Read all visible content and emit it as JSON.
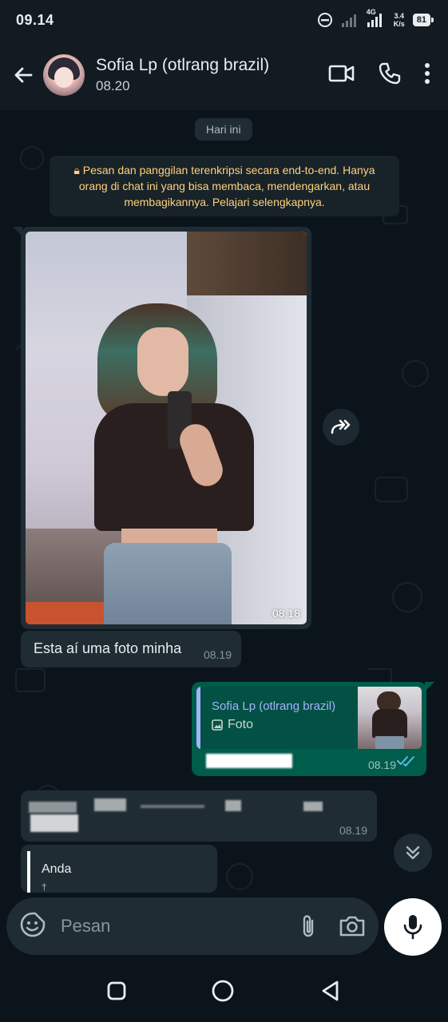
{
  "status_bar": {
    "time": "09.14",
    "network": "4G",
    "speed_value": "3.4",
    "speed_unit": "K/s",
    "battery": "81"
  },
  "header": {
    "contact_name": "Sofia Lp (otlrang brazil)",
    "last_seen": "08.20"
  },
  "chat": {
    "day_label": "Hari ini",
    "encryption_notice": "Pesan dan panggilan terenkripsi secara end-to-end. Hanya orang di chat ini yang bisa membaca, mendengarkan, atau membagikannya. Pelajari selengkapnya.",
    "messages": [
      {
        "type": "image",
        "direction": "in",
        "time": "08.18"
      },
      {
        "type": "text",
        "direction": "in",
        "text": "Esta aí uma foto minha",
        "time": "08.19"
      },
      {
        "type": "reply",
        "direction": "out",
        "quote_name": "Sofia Lp (otlrang brazil)",
        "quote_type": "Foto",
        "time": "08.19",
        "status": "read"
      },
      {
        "type": "text",
        "direction": "in",
        "time": "08.19"
      },
      {
        "type": "reply",
        "direction": "in",
        "quote_name": "Anda",
        "quote_more": "†"
      }
    ]
  },
  "composer": {
    "placeholder": "Pesan"
  },
  "colors": {
    "background": "#0b141a",
    "incoming_bubble": "#1f2c33",
    "outgoing_bubble": "#005c4b",
    "notice_text": "#ffd279",
    "quote_accent": "#a5b1ff",
    "read_ticks": "#53bdeb"
  }
}
